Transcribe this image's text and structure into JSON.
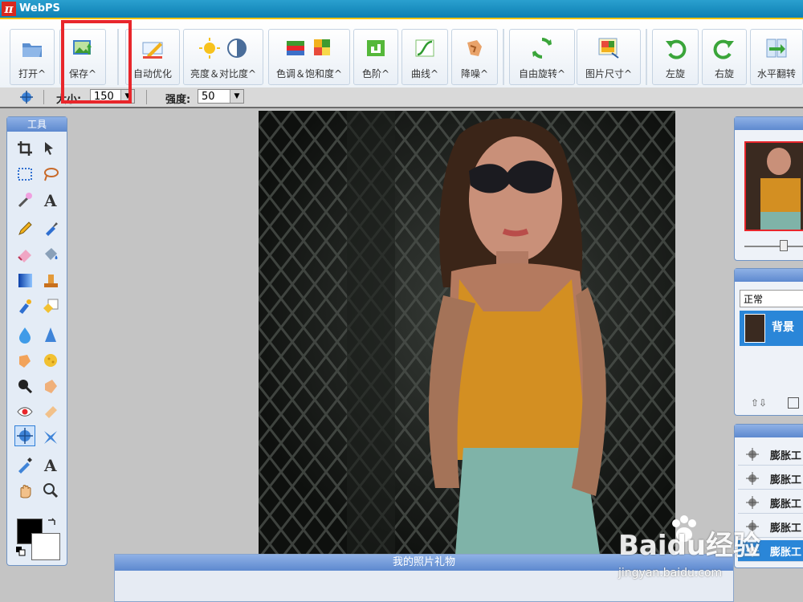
{
  "app": {
    "title": "WebPS",
    "logo_glyph": "π"
  },
  "toolbar": {
    "buttons": [
      {
        "label": "打开^",
        "icon": "folder-open-icon"
      },
      {
        "label": "保存^",
        "icon": "save-image-icon"
      },
      {
        "label": "自动优化",
        "icon": "auto-enhance-icon"
      },
      {
        "label": "亮度＆对比度^",
        "icon": "brightness-contrast-icon"
      },
      {
        "label": "色调＆饱和度^",
        "icon": "hue-saturation-icon"
      },
      {
        "label": "色阶^",
        "icon": "levels-icon"
      },
      {
        "label": "曲线^",
        "icon": "curves-icon"
      },
      {
        "label": "降噪^",
        "icon": "denoise-icon"
      },
      {
        "label": "自由旋转^",
        "icon": "free-rotate-icon"
      },
      {
        "label": "图片尺寸^",
        "icon": "image-size-icon"
      },
      {
        "label": "左旋",
        "icon": "rotate-left-icon"
      },
      {
        "label": "右旋",
        "icon": "rotate-right-icon"
      },
      {
        "label": "水平翻转",
        "icon": "flip-horizontal-icon"
      }
    ]
  },
  "options": {
    "size_label": "大小:",
    "size_value": "150",
    "strength_label": "强度:",
    "strength_value": "50"
  },
  "tools_panel": {
    "title": "工具"
  },
  "layers": {
    "blend_mode": "正常",
    "layer_name": "背景"
  },
  "history": {
    "items": [
      "膨胀工",
      "膨胀工",
      "膨胀工",
      "膨胀工",
      "膨胀工"
    ]
  },
  "bottom_panel": {
    "title": "我的照片礼物"
  },
  "watermark": {
    "brand": "Baidu经验",
    "url": "jingyan.baidu.com"
  },
  "colors": {
    "title_bar": "#1a8fc3",
    "panel_header": "#6f97da",
    "highlight": "#e8262b",
    "foreground": "#000000",
    "background": "#ffffff"
  }
}
